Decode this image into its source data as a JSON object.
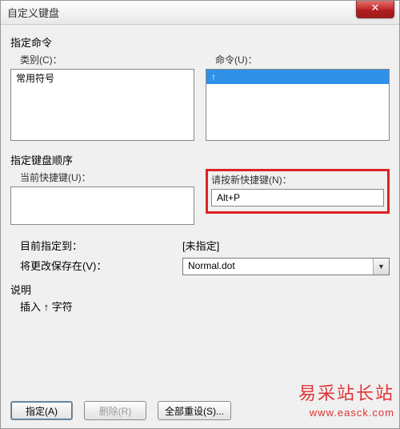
{
  "title": "自定义键盘",
  "close_glyph": "✕",
  "section_command": "指定命令",
  "label_category": "类别(C)：",
  "label_command": "命令(U)：",
  "category_items": [
    "常用符号"
  ],
  "command_items": [
    " ↑"
  ],
  "section_sequence": "指定键盘顺序",
  "label_current": "当前快捷键(U)：",
  "label_newkey": "请按新快捷键(N)：",
  "newkey_value": "Alt+P",
  "label_target": "目前指定到：",
  "value_target": "[未指定]",
  "label_savein": "将更改保存在(V)：",
  "value_savein": "Normal.dot",
  "section_desc": "说明",
  "desc_text": "插入   ↑   字符",
  "btn_assign": "指定(A)",
  "btn_remove": "删除(R)",
  "btn_reset": "全部重设(S)...",
  "wm1": "易采站长站",
  "wm2": "www.easck.com"
}
